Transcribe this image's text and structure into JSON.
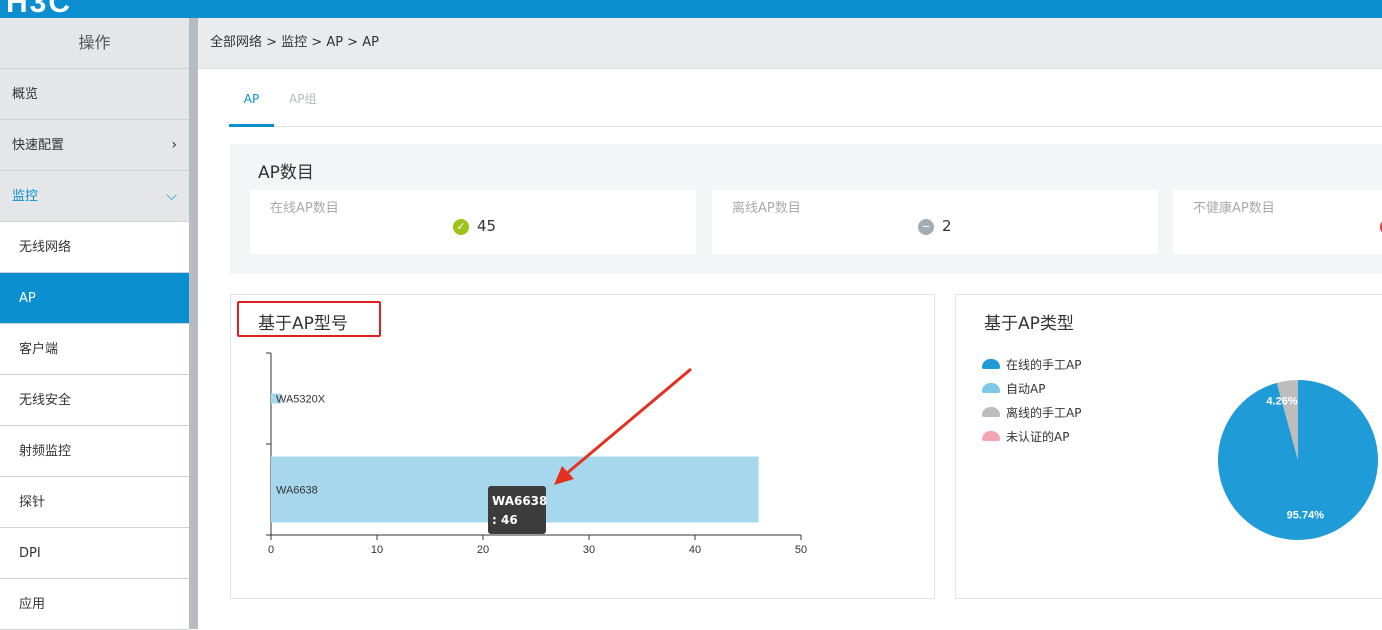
{
  "logo": {
    "text": "H3C"
  },
  "sidebar": {
    "header": "操作",
    "items": [
      {
        "label": "概览",
        "level": 1
      },
      {
        "label": "快速配置",
        "level": 1,
        "chevron": "chevron-right-icon"
      },
      {
        "label": "监控",
        "level": 1,
        "chevron": "chevron-down-icon",
        "open": true
      },
      {
        "label": "无线网络",
        "level": 2
      },
      {
        "label": "AP",
        "level": 2,
        "active": true
      },
      {
        "label": "客户端",
        "level": 2
      },
      {
        "label": "无线安全",
        "level": 2
      },
      {
        "label": "射频监控",
        "level": 2
      },
      {
        "label": "探针",
        "level": 2
      },
      {
        "label": "DPI",
        "level": 2
      },
      {
        "label": "应用",
        "level": 2
      }
    ]
  },
  "breadcrumb": {
    "text": "全部网络 > 监控 > AP > AP"
  },
  "tabs": [
    {
      "label": "AP",
      "active": true
    },
    {
      "label": "AP组",
      "active": false
    }
  ],
  "ap_count": {
    "title": "AP数目",
    "cards": [
      {
        "label": "在线AP数目",
        "value": "45",
        "icon": "check-circle-icon",
        "color": "#9cc41c"
      },
      {
        "label": "离线AP数目",
        "value": "2",
        "icon": "minus-circle-icon",
        "color": "#a3adb6"
      },
      {
        "label": "不健康AP数目",
        "value": "",
        "icon": "alert-circle-icon",
        "color": "#e53935"
      }
    ]
  },
  "chart_model": {
    "title": "基于AP型号",
    "tooltip": {
      "name": "WA6638",
      "value": ": 46"
    }
  },
  "chart_type": {
    "title": "基于AP类型",
    "legend": [
      {
        "label": "在线的手工AP",
        "color": "#1f9bd7"
      },
      {
        "label": "自动AP",
        "color": "#7ec8ea"
      },
      {
        "label": "离线的手工AP",
        "color": "#bdbdbd"
      },
      {
        "label": "未认证的AP",
        "color": "#f4a5b3"
      }
    ]
  },
  "chart_data": [
    {
      "type": "bar",
      "orientation": "horizontal",
      "categories": [
        "WA5320X",
        "WA6638"
      ],
      "values": [
        1,
        46
      ],
      "xlim": [
        0,
        50
      ],
      "xticks": [
        0,
        10,
        20,
        30,
        40,
        50
      ],
      "color": "#a6d7ec"
    },
    {
      "type": "pie",
      "slices": [
        {
          "label": "95.74%",
          "value": 95.74,
          "color": "#1f9bd7"
        },
        {
          "label": "4.26%",
          "value": 4.26,
          "color": "#bdbdbd"
        }
      ]
    }
  ]
}
